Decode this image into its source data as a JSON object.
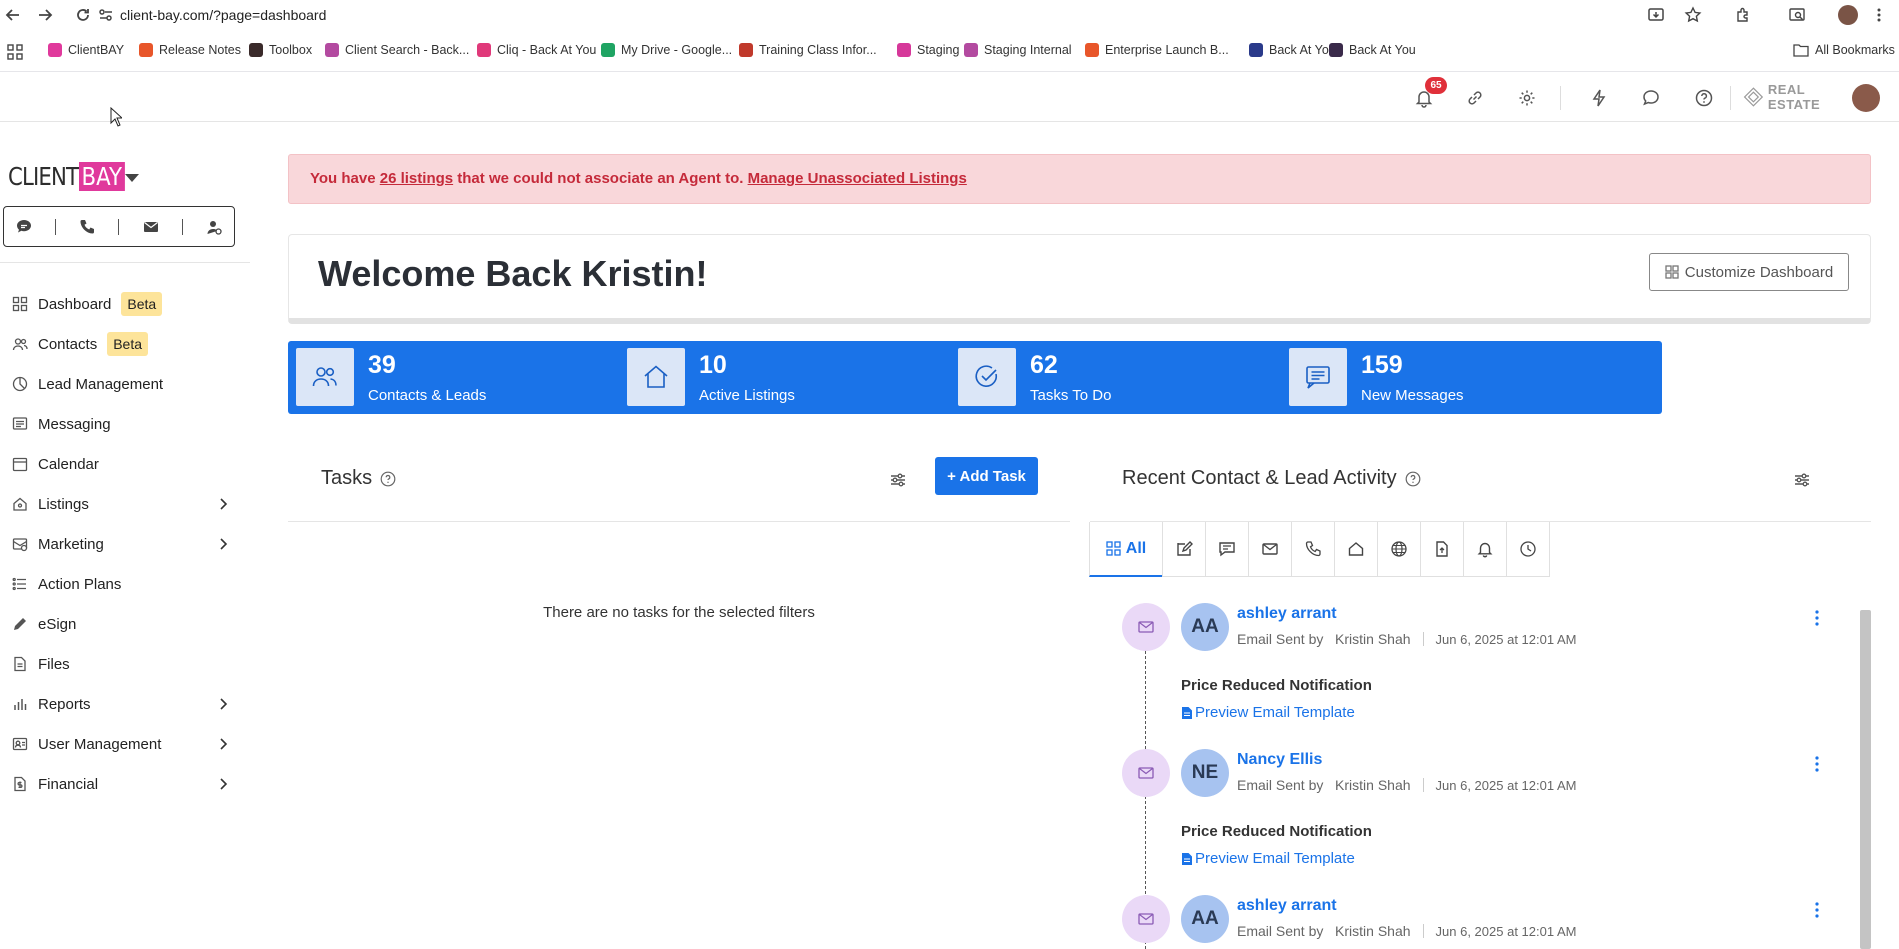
{
  "browser": {
    "url": "client-bay.com/?page=dashboard",
    "bookmarks": [
      {
        "label": "ClientBAY",
        "color": "#e0399c"
      },
      {
        "label": "Release Notes",
        "color": "#e8562a"
      },
      {
        "label": "Toolbox",
        "color": "#3a2a2a"
      },
      {
        "label": "Client Search - Back...",
        "color": "#b34aa0"
      },
      {
        "label": "Cliq - Back At You",
        "color": "#e0397a"
      },
      {
        "label": "My Drive - Google...",
        "color": "#1fa463"
      },
      {
        "label": "Training Class Infor...",
        "color": "#c0392b"
      },
      {
        "label": "Staging",
        "color": "#d6389a"
      },
      {
        "label": "Staging Internal",
        "color": "#b34aa0"
      },
      {
        "label": "Enterprise Launch B...",
        "color": "#e8562a"
      },
      {
        "label": "Back At You",
        "color": "#2a3a8a"
      },
      {
        "label": "Back At You",
        "color": "#3a2a4a"
      }
    ],
    "all_bookmarks": "All Bookmarks"
  },
  "header": {
    "notification_count": "65",
    "brand_text": "REAL ESTATE"
  },
  "sidebar": {
    "logo_left": "CLIENT",
    "logo_right": "BAY",
    "items": [
      {
        "label": "Dashboard",
        "badge": "Beta",
        "icon": "dashboard-icon",
        "has_chevron": false
      },
      {
        "label": "Contacts",
        "badge": "Beta",
        "icon": "contacts-icon",
        "has_chevron": false
      },
      {
        "label": "Lead Management",
        "badge": "",
        "icon": "lead-icon",
        "has_chevron": false
      },
      {
        "label": "Messaging",
        "badge": "",
        "icon": "messaging-icon",
        "has_chevron": false
      },
      {
        "label": "Calendar",
        "badge": "",
        "icon": "calendar-icon",
        "has_chevron": false
      },
      {
        "label": "Listings",
        "badge": "",
        "icon": "listings-icon",
        "has_chevron": true
      },
      {
        "label": "Marketing",
        "badge": "",
        "icon": "marketing-icon",
        "has_chevron": true
      },
      {
        "label": "Action Plans",
        "badge": "",
        "icon": "action-plans-icon",
        "has_chevron": false
      },
      {
        "label": "eSign",
        "badge": "",
        "icon": "esign-icon",
        "has_chevron": false
      },
      {
        "label": "Files",
        "badge": "",
        "icon": "files-icon",
        "has_chevron": false
      },
      {
        "label": "Reports",
        "badge": "",
        "icon": "reports-icon",
        "has_chevron": true
      },
      {
        "label": "User Management",
        "badge": "",
        "icon": "user-management-icon",
        "has_chevron": true
      },
      {
        "label": "Financial",
        "badge": "",
        "icon": "financial-icon",
        "has_chevron": true
      }
    ]
  },
  "alert": {
    "prefix": "You have ",
    "link1": "26 listings",
    "middle": " that we could not associate an Agent to. ",
    "link2": "Manage Unassociated Listings"
  },
  "welcome": {
    "title": "Welcome Back Kristin!",
    "customize": "Customize Dashboard"
  },
  "stats": [
    {
      "value": "39",
      "label": "Contacts & Leads",
      "icon": "contacts-leads-icon"
    },
    {
      "value": "10",
      "label": "Active Listings",
      "icon": "house-icon"
    },
    {
      "value": "62",
      "label": "Tasks To Do",
      "icon": "task-check-icon"
    },
    {
      "value": "159",
      "label": "New Messages",
      "icon": "message-icon"
    }
  ],
  "tasks": {
    "title": "Tasks",
    "add_label": "+ Add Task",
    "empty": "There are no tasks for the selected filters"
  },
  "activity": {
    "title": "Recent Contact & Lead Activity",
    "tab_all": "All",
    "entries": [
      {
        "initials": "AA",
        "name": "ashley arrant",
        "action": "Email Sent by",
        "agent": "Kristin Shah",
        "date": "Jun 6, 2025 at 12:01 AM",
        "subject": "Price Reduced Notification",
        "preview": "Preview Email Template"
      },
      {
        "initials": "NE",
        "name": "Nancy Ellis",
        "action": "Email Sent by",
        "agent": "Kristin Shah",
        "date": "Jun 6, 2025 at 12:01 AM",
        "subject": "Price Reduced Notification",
        "preview": "Preview Email Template"
      },
      {
        "initials": "AA",
        "name": "ashley arrant",
        "action": "Email Sent by",
        "agent": "Kristin Shah",
        "date": "Jun 6, 2025 at 12:01 AM",
        "subject": "",
        "preview": ""
      }
    ]
  },
  "colors": {
    "primary": "#1a73e8",
    "brand_pink": "#e0399c",
    "alert_bg": "#f9d7da",
    "alert_text": "#c52a3a",
    "beta_bg": "#fde49a"
  }
}
